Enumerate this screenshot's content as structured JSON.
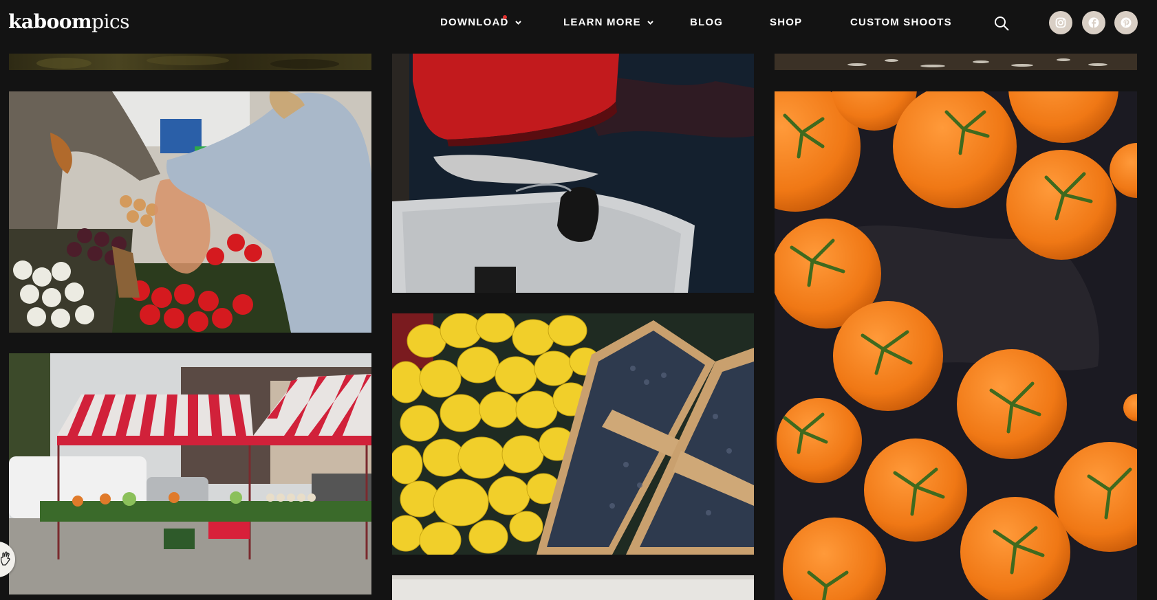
{
  "brand": {
    "logo_bold": "kaboom",
    "logo_light": "pics"
  },
  "nav": {
    "download": "DOWNLOAD",
    "learn_more": "LEARN MORE",
    "blog": "BLOG",
    "shop": "SHOP",
    "custom_shoots": "CUSTOM SHOOTS"
  },
  "icons": {
    "search": "search-icon",
    "instagram": "instagram-icon",
    "facebook": "facebook-icon",
    "pinterest": "pinterest-icon"
  },
  "colors": {
    "background": "#131313",
    "text": "#ffffff",
    "notification_dot": "#e0312f",
    "social_bg": "#d9cfc5"
  },
  "gallery": [
    "photo-forest-top",
    "photo-boat-water",
    "photo-water-top",
    "photo-market-shopping",
    "photo-tomatoes",
    "photo-lemons-blueberries",
    "photo-market-stall",
    "photo-partial-bottom"
  ]
}
